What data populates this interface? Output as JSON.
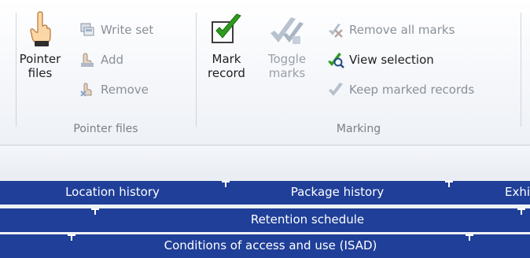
{
  "ribbon": {
    "pointer_files_group": {
      "label": "Pointer files",
      "large_button": {
        "line1": "Pointer",
        "line2": "files"
      },
      "small_buttons": [
        {
          "label": "Write set"
        },
        {
          "label": "Add"
        },
        {
          "label": "Remove"
        }
      ]
    },
    "marking_group": {
      "label": "Marking",
      "mark_record": {
        "line1": "Mark",
        "line2": "record"
      },
      "toggle_marks": {
        "line1": "Toggle",
        "line2": "marks"
      },
      "small_buttons": [
        {
          "label": "Remove all marks"
        },
        {
          "label": "View selection"
        },
        {
          "label": "Keep marked records"
        }
      ]
    }
  },
  "tabs": {
    "row1": [
      "Location history",
      "Package history",
      "Exhi"
    ],
    "row2": [
      "Retention schedule"
    ],
    "row3": [
      "Conditions of access and use (ISAD)"
    ]
  },
  "colors": {
    "tab_background": "#1f3f98",
    "ribbon_background": "#f4f6fa",
    "check_green": "#2e9b1f",
    "disabled_text": "#8a9099"
  }
}
